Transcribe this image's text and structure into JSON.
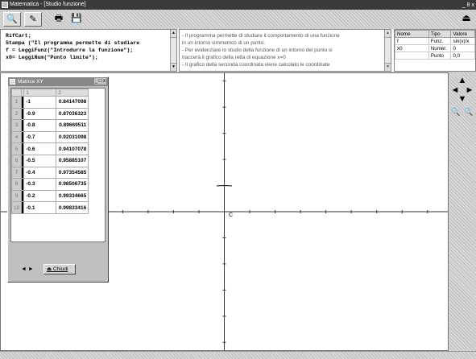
{
  "window": {
    "title": "Matematica - [Studio funzione]",
    "buttons": "_ 8 x"
  },
  "toolbar": {
    "buttons": [
      "search-icon",
      "pencil-icon",
      "printer-icon",
      "save-icon"
    ],
    "exit_icon": "exit-icon"
  },
  "code": {
    "lines": [
      "RifCart;",
      "Stampa (\"Il programma permette di studiare",
      "f = LeggiFunz(\"Introdurre la funzione\");",
      "x0= LeggiNum(\"Punto limite\");"
    ]
  },
  "description": {
    "lines": [
      "- Il programma permette di studiare il comportamento    di una funzione",
      "in un intorno simmetrico di un      punto.",
      "- Per evidenziare lo studio della funzione di un      intorno del punto si",
      "traccerà il grafico della       retta di equazione x=0",
      "- Il grafico della seconda coordinata viene    calcolato le coordinate"
    ]
  },
  "var_table": {
    "headers": [
      "Nome",
      "Tipo",
      "Valore"
    ],
    "rows": [
      [
        "f",
        "Funz.",
        "sin(x)/x"
      ],
      [
        "x0",
        "Numer.",
        "0"
      ],
      [
        "",
        "Punto",
        "0,0"
      ]
    ]
  },
  "matrix": {
    "title": "Matrice XY",
    "headers": [
      "1",
      "2"
    ],
    "rows": [
      [
        "1",
        "-1",
        "0.84147098"
      ],
      [
        "2",
        "-0.9",
        "0.87036323"
      ],
      [
        "3",
        "-0.8",
        "0.89669511"
      ],
      [
        "4",
        "-0.7",
        "0.92031098"
      ],
      [
        "5",
        "-0.6",
        "0.94107078"
      ],
      [
        "6",
        "-0.5",
        "0.95885107"
      ],
      [
        "7",
        "-0.4",
        "0.97354585"
      ],
      [
        "8",
        "-0.3",
        "0.98506735"
      ],
      [
        "9",
        "-0.2",
        "0.99334665"
      ],
      [
        "10",
        "-0.1",
        "0.99833416"
      ]
    ],
    "close_label": "Chiudi",
    "nav": "◄ ►"
  },
  "plot": {
    "origin_label": "C"
  },
  "right_panel": {
    "nav_up": "▲",
    "nav_left": "◄",
    "nav_right": "►",
    "nav_down": "▼",
    "zoom_in": "🔍",
    "zoom_out": "🔍"
  },
  "chart_data": {
    "type": "line",
    "x": [
      -0.3,
      -0.2,
      -0.1,
      0,
      0.1,
      0.2,
      0.3
    ],
    "y": [
      0.985,
      0.993,
      0.998,
      1.0,
      0.998,
      0.993,
      0.985
    ],
    "xlim": [
      -8.8,
      8.8
    ],
    "ylim": [
      -5.3,
      5.3
    ]
  },
  "colors": {
    "background": "#c8c8c8",
    "plot": "#ffffff",
    "titlebar": "#3a3a3a"
  }
}
